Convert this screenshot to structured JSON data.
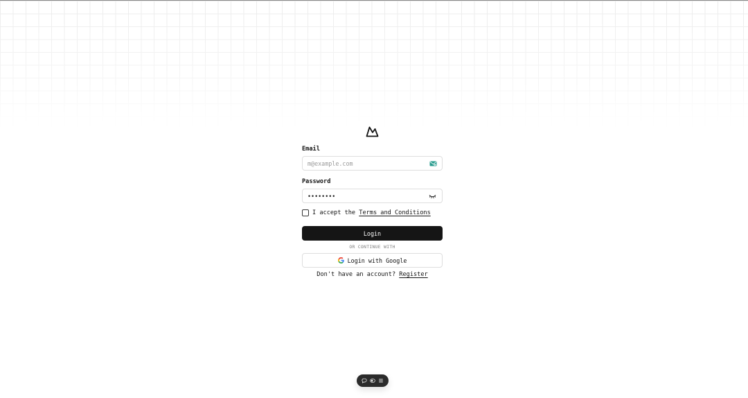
{
  "form": {
    "email_label": "Email",
    "email_placeholder": "m@example.com",
    "email_value": "",
    "password_label": "Password",
    "password_value": "12345678",
    "terms_prefix": "I accept the ",
    "terms_link": "Terms and Conditions",
    "terms_checked": false,
    "login_button": "Login",
    "divider": "OR CONTINUE WITH",
    "google_button": "Login with Google",
    "register_prefix": "Don't have an account? ",
    "register_link": "Register"
  },
  "icons": {
    "logo": "mountain-logo-icon",
    "email": "envelope-icon",
    "password": "eye-closed-icon",
    "google": "google-icon",
    "toolbar": [
      "chat-icon",
      "toggle-icon",
      "menu-icon"
    ]
  },
  "colors": {
    "primary_button": "#151515",
    "email_icon": "#2a9d8f",
    "border": "#dedede"
  }
}
